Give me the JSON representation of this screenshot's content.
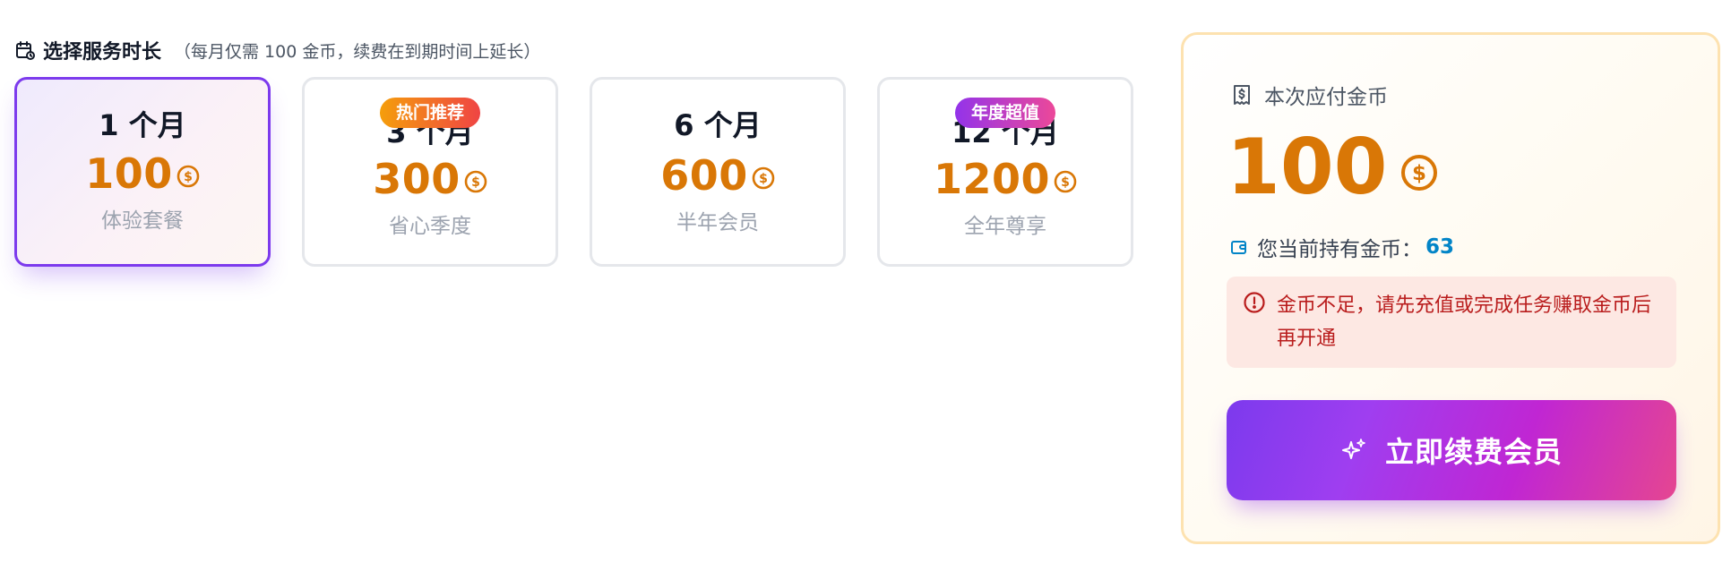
{
  "section": {
    "title": "选择服务时长",
    "note": "（每月仅需 100 金币，续费在到期时间上延长）",
    "icon": "calendar-icon"
  },
  "plans": [
    {
      "months": "1 个月",
      "price": "100",
      "desc": "体验套餐",
      "badge": "",
      "selected": true
    },
    {
      "months": "3 个月",
      "price": "300",
      "desc": "省心季度",
      "badge": "热门推荐",
      "selected": false
    },
    {
      "months": "6 个月",
      "price": "600",
      "desc": "半年会员",
      "badge": "",
      "selected": false
    },
    {
      "months": "12 个月",
      "price": "1200",
      "desc": "全年尊享",
      "badge": "年度超值",
      "selected": false
    }
  ],
  "payment": {
    "label": "本次应付金币",
    "amount": "100",
    "balance_label": "您当前持有金币：",
    "balance_value": "63",
    "warning": "金币不足，请先充值或完成任务赚取金币后再开通",
    "button_label": "立即续费会员"
  },
  "colors": {
    "accent_purple": "#7c3aed",
    "coin_orange": "#d97706",
    "balance_blue": "#0284c7",
    "warning_red": "#b91c1c"
  }
}
